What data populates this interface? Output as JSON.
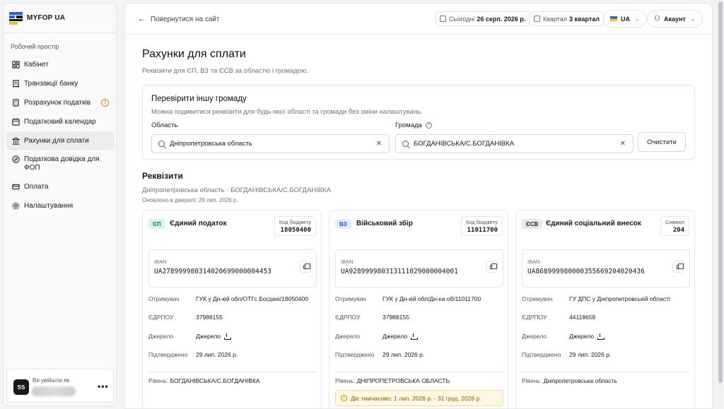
{
  "app": {
    "name": "MYFOP UA"
  },
  "sidebar": {
    "section_label": "Робочий простір",
    "items": [
      {
        "label": "Кабінет",
        "icon": "dashboard-icon"
      },
      {
        "label": "Транзакції банку",
        "icon": "receipt-icon"
      },
      {
        "label": "Розрахунок податків",
        "icon": "calculator-icon",
        "badge": "!"
      },
      {
        "label": "Податковий календар",
        "icon": "calendar-icon"
      },
      {
        "label": "Рахунки для сплати",
        "icon": "bank-icon",
        "active": true
      },
      {
        "label": "Податкова довідка для ФОП",
        "icon": "compass-icon"
      },
      {
        "label": "Оплата",
        "icon": "card-icon"
      },
      {
        "label": "Налаштування",
        "icon": "gear-icon"
      }
    ],
    "user": {
      "logged_as": "Ви увійшли як",
      "initials": "SS",
      "more": "•••"
    }
  },
  "topbar": {
    "back_label": "Повернутися на сайт",
    "today_label": "Сьогодні",
    "today_value": "26 серп. 2026 р.",
    "quarter_label": "Квартал",
    "quarter_value": "3 квартал",
    "lang": "UA",
    "account": "Акаунт"
  },
  "page": {
    "title": "Рахунки для сплати",
    "subtitle": "Реквізити для ЄП, ВЗ та ЄСВ за областю і громадою."
  },
  "checker": {
    "title": "Перевірити іншу громаду",
    "subtitle": "Можна подивитися реквізити для будь-якої області та громади без зміни налаштувань.",
    "region_label": "Область",
    "region_value": "Дніпропетровська область",
    "community_label": "Громада",
    "community_value": "БОГДАНІВСЬКА/С.БОГДАНІВКА",
    "clear_label": "Очистити"
  },
  "requisites": {
    "title": "Реквізити",
    "location": "Дніпропетровська область · БОГДАНІВСЬКА/С.БОГДАНІВКА",
    "updated": "Оновлено в джерелі: 29 лип. 2026 р."
  },
  "labels": {
    "iban": "IBAN",
    "recipient": "Отримувач",
    "edrpou": "ЄДРПОУ",
    "source": "Джерело",
    "confirmed": "Підтверджено",
    "level": "Рівень:"
  },
  "cards": [
    {
      "badge": "ЄП",
      "name": "Єдиний податок",
      "code_label": "Код бюджету",
      "code_value": "18050400",
      "iban": "UA278999980314020699000004453",
      "recipient": "ГУК у Дн-кій обл/ОТГс.Богдані/18050400",
      "edrpou": "37988155",
      "source": "Джерело",
      "confirmed": "29 лип. 2026 р.",
      "level": "БОГДАНІВСЬКА/С.БОГДАНІВКА"
    },
    {
      "badge": "ВЗ",
      "name": "Військовий збір",
      "code_label": "Код бюджету",
      "code_value": "11011700",
      "iban": "UA928999980313111029000004001",
      "recipient": "ГУК у Дн-кій обл/Дн-ка об/11011700",
      "edrpou": "37988155",
      "source": "Джерело",
      "confirmed": "29 лип. 2026 р.",
      "level": "ДНІПРОПЕТРОВСЬКА ОБЛАСТЬ",
      "note": "Діє тимчасово: 1 лип. 2026 р. - 31 груд. 2026 р."
    },
    {
      "badge": "ЄСВ",
      "name": "Єдиний соціальний внесок",
      "code_label": "Символ",
      "code_value": "204",
      "iban": "UA868999980000355669204020436",
      "recipient": "ГУ ДПС у Дніпропетровській області",
      "edrpou": "44118658",
      "source": "Джерело",
      "confirmed": "29 лип. 2026 р.",
      "level": "Дніпропетровська область"
    }
  ],
  "colors": {
    "accent_green_bg": "#dcf4e4",
    "accent_green_fg": "#15803d",
    "accent_blue_bg": "#e0ecfb",
    "accent_blue_fg": "#1d4ed8",
    "neutral_bg": "#e8e8ea",
    "warning": "#e07a16"
  }
}
